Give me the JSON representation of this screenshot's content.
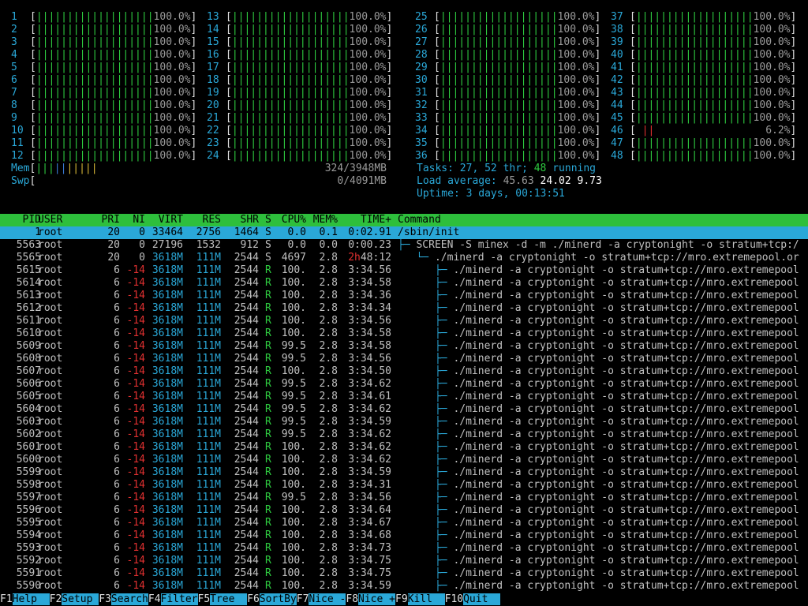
{
  "cpus": [
    {
      "n": "1",
      "pct": "100.0%"
    },
    {
      "n": "2",
      "pct": "100.0%"
    },
    {
      "n": "3",
      "pct": "100.0%"
    },
    {
      "n": "4",
      "pct": "100.0%"
    },
    {
      "n": "5",
      "pct": "100.0%"
    },
    {
      "n": "6",
      "pct": "100.0%"
    },
    {
      "n": "7",
      "pct": "100.0%"
    },
    {
      "n": "8",
      "pct": "100.0%"
    },
    {
      "n": "9",
      "pct": "100.0%"
    },
    {
      "n": "10",
      "pct": "100.0%"
    },
    {
      "n": "11",
      "pct": "100.0%"
    },
    {
      "n": "12",
      "pct": "100.0%"
    },
    {
      "n": "13",
      "pct": "100.0%"
    },
    {
      "n": "14",
      "pct": "100.0%"
    },
    {
      "n": "15",
      "pct": "100.0%"
    },
    {
      "n": "16",
      "pct": "100.0%"
    },
    {
      "n": "17",
      "pct": "100.0%"
    },
    {
      "n": "18",
      "pct": "100.0%"
    },
    {
      "n": "19",
      "pct": "100.0%"
    },
    {
      "n": "20",
      "pct": "100.0%"
    },
    {
      "n": "21",
      "pct": "100.0%"
    },
    {
      "n": "22",
      "pct": "100.0%"
    },
    {
      "n": "23",
      "pct": "100.0%"
    },
    {
      "n": "24",
      "pct": "100.0%"
    },
    {
      "n": "25",
      "pct": "100.0%"
    },
    {
      "n": "26",
      "pct": "100.0%"
    },
    {
      "n": "27",
      "pct": "100.0%"
    },
    {
      "n": "28",
      "pct": "100.0%"
    },
    {
      "n": "29",
      "pct": "100.0%"
    },
    {
      "n": "30",
      "pct": "100.0%"
    },
    {
      "n": "31",
      "pct": "100.0%"
    },
    {
      "n": "32",
      "pct": "100.0%"
    },
    {
      "n": "33",
      "pct": "100.0%"
    },
    {
      "n": "34",
      "pct": "100.0%"
    },
    {
      "n": "35",
      "pct": "100.0%"
    },
    {
      "n": "36",
      "pct": "100.0%"
    },
    {
      "n": "37",
      "pct": "100.0%"
    },
    {
      "n": "38",
      "pct": "100.0%"
    },
    {
      "n": "39",
      "pct": "100.0%"
    },
    {
      "n": "40",
      "pct": "100.0%"
    },
    {
      "n": "41",
      "pct": "100.0%"
    },
    {
      "n": "42",
      "pct": "100.0%"
    },
    {
      "n": "43",
      "pct": "100.0%"
    },
    {
      "n": "44",
      "pct": "100.0%"
    },
    {
      "n": "45",
      "pct": "100.0%"
    },
    {
      "n": "46",
      "pct": "6.2%",
      "low": true
    },
    {
      "n": "47",
      "pct": "100.0%"
    },
    {
      "n": "48",
      "pct": "100.0%"
    }
  ],
  "memory": {
    "mem_label": "Mem",
    "mem_value": "324/3948MB",
    "swp_label": "Swp",
    "swp_value": "0/4091MB"
  },
  "summary": {
    "tasks_label": "Tasks:",
    "tasks_count": "27,",
    "threads": "52 thr;",
    "running_count": "48",
    "running_label": "running",
    "load_label": "Load average:",
    "load1": "45.63",
    "load5": "24.02",
    "load15": "9.73",
    "uptime_label": "Uptime:",
    "uptime_value": "3 days, 00:13:51"
  },
  "table_header": {
    "pid": "PID",
    "user": "USER",
    "pri": "PRI",
    "ni": "NI",
    "virt": "VIRT",
    "res": "RES",
    "shr": "SHR",
    "s": "S",
    "cpu": "CPU%",
    "mem": "MEM%",
    "time": "TIME+",
    "command": "Command"
  },
  "processes": [
    {
      "pid": "1",
      "user": "root",
      "pri": "20",
      "ni": "0",
      "virt": "33464",
      "res": "2756",
      "shr": "1464",
      "s": "S",
      "cpu": "0.0",
      "mem": "0.1",
      "time": "0:02.91",
      "tree": "",
      "cmd": "/sbin/init"
    },
    {
      "pid": "5563",
      "user": "root",
      "pri": "20",
      "ni": "0",
      "virt": "27196",
      "res": "1532",
      "shr": "912",
      "s": "S",
      "cpu": "0.0",
      "mem": "0.0",
      "time": "0:00.23",
      "tree": "├─ ",
      "cmd": "SCREEN -S minex -d -m ./minerd -a cryptonight -o stratum+tcp:/"
    },
    {
      "pid": "5565",
      "user": "root",
      "pri": "20",
      "ni": "0",
      "virt": "3618M",
      "res": "111M",
      "shr": "2544",
      "s": "S",
      "cpu": "4697",
      "mem": "2.8",
      "time": "48:12",
      "time_hours": "2h",
      "tree": "   └─ ",
      "cmd": "./minerd -a cryptonight -o stratum+tcp://mro.extremepool.or"
    },
    {
      "pid": "5615",
      "user": "root",
      "pri": "6",
      "ni": "-14",
      "virt": "3618M",
      "res": "111M",
      "shr": "2544",
      "s": "R",
      "cpu": "100.",
      "mem": "2.8",
      "time": "3:34.56",
      "tree": "      ├─ ",
      "cmd": "./minerd -a cryptonight -o stratum+tcp://mro.extremepool"
    },
    {
      "pid": "5614",
      "user": "root",
      "pri": "6",
      "ni": "-14",
      "virt": "3618M",
      "res": "111M",
      "shr": "2544",
      "s": "R",
      "cpu": "100.",
      "mem": "2.8",
      "time": "3:34.58",
      "tree": "      ├─ ",
      "cmd": "./minerd -a cryptonight -o stratum+tcp://mro.extremepool"
    },
    {
      "pid": "5613",
      "user": "root",
      "pri": "6",
      "ni": "-14",
      "virt": "3618M",
      "res": "111M",
      "shr": "2544",
      "s": "R",
      "cpu": "100.",
      "mem": "2.8",
      "time": "3:34.36",
      "tree": "      ├─ ",
      "cmd": "./minerd -a cryptonight -o stratum+tcp://mro.extremepool"
    },
    {
      "pid": "5612",
      "user": "root",
      "pri": "6",
      "ni": "-14",
      "virt": "3618M",
      "res": "111M",
      "shr": "2544",
      "s": "R",
      "cpu": "100.",
      "mem": "2.8",
      "time": "3:34.34",
      "tree": "      ├─ ",
      "cmd": "./minerd -a cryptonight -o stratum+tcp://mro.extremepool"
    },
    {
      "pid": "5611",
      "user": "root",
      "pri": "6",
      "ni": "-14",
      "virt": "3618M",
      "res": "111M",
      "shr": "2544",
      "s": "R",
      "cpu": "100.",
      "mem": "2.8",
      "time": "3:34.56",
      "tree": "      ├─ ",
      "cmd": "./minerd -a cryptonight -o stratum+tcp://mro.extremepool"
    },
    {
      "pid": "5610",
      "user": "root",
      "pri": "6",
      "ni": "-14",
      "virt": "3618M",
      "res": "111M",
      "shr": "2544",
      "s": "R",
      "cpu": "100.",
      "mem": "2.8",
      "time": "3:34.58",
      "tree": "      ├─ ",
      "cmd": "./minerd -a cryptonight -o stratum+tcp://mro.extremepool"
    },
    {
      "pid": "5609",
      "user": "root",
      "pri": "6",
      "ni": "-14",
      "virt": "3618M",
      "res": "111M",
      "shr": "2544",
      "s": "R",
      "cpu": "99.5",
      "mem": "2.8",
      "time": "3:34.58",
      "tree": "      ├─ ",
      "cmd": "./minerd -a cryptonight -o stratum+tcp://mro.extremepool"
    },
    {
      "pid": "5608",
      "user": "root",
      "pri": "6",
      "ni": "-14",
      "virt": "3618M",
      "res": "111M",
      "shr": "2544",
      "s": "R",
      "cpu": "99.5",
      "mem": "2.8",
      "time": "3:34.56",
      "tree": "      ├─ ",
      "cmd": "./minerd -a cryptonight -o stratum+tcp://mro.extremepool"
    },
    {
      "pid": "5607",
      "user": "root",
      "pri": "6",
      "ni": "-14",
      "virt": "3618M",
      "res": "111M",
      "shr": "2544",
      "s": "R",
      "cpu": "100.",
      "mem": "2.8",
      "time": "3:34.50",
      "tree": "      ├─ ",
      "cmd": "./minerd -a cryptonight -o stratum+tcp://mro.extremepool"
    },
    {
      "pid": "5606",
      "user": "root",
      "pri": "6",
      "ni": "-14",
      "virt": "3618M",
      "res": "111M",
      "shr": "2544",
      "s": "R",
      "cpu": "99.5",
      "mem": "2.8",
      "time": "3:34.62",
      "tree": "      ├─ ",
      "cmd": "./minerd -a cryptonight -o stratum+tcp://mro.extremepool"
    },
    {
      "pid": "5605",
      "user": "root",
      "pri": "6",
      "ni": "-14",
      "virt": "3618M",
      "res": "111M",
      "shr": "2544",
      "s": "R",
      "cpu": "99.5",
      "mem": "2.8",
      "time": "3:34.61",
      "tree": "      ├─ ",
      "cmd": "./minerd -a cryptonight -o stratum+tcp://mro.extremepool"
    },
    {
      "pid": "5604",
      "user": "root",
      "pri": "6",
      "ni": "-14",
      "virt": "3618M",
      "res": "111M",
      "shr": "2544",
      "s": "R",
      "cpu": "99.5",
      "mem": "2.8",
      "time": "3:34.62",
      "tree": "      ├─ ",
      "cmd": "./minerd -a cryptonight -o stratum+tcp://mro.extremepool"
    },
    {
      "pid": "5603",
      "user": "root",
      "pri": "6",
      "ni": "-14",
      "virt": "3618M",
      "res": "111M",
      "shr": "2544",
      "s": "R",
      "cpu": "99.5",
      "mem": "2.8",
      "time": "3:34.59",
      "tree": "      ├─ ",
      "cmd": "./minerd -a cryptonight -o stratum+tcp://mro.extremepool"
    },
    {
      "pid": "5602",
      "user": "root",
      "pri": "6",
      "ni": "-14",
      "virt": "3618M",
      "res": "111M",
      "shr": "2544",
      "s": "R",
      "cpu": "99.5",
      "mem": "2.8",
      "time": "3:34.62",
      "tree": "      ├─ ",
      "cmd": "./minerd -a cryptonight -o stratum+tcp://mro.extremepool"
    },
    {
      "pid": "5601",
      "user": "root",
      "pri": "6",
      "ni": "-14",
      "virt": "3618M",
      "res": "111M",
      "shr": "2544",
      "s": "R",
      "cpu": "100.",
      "mem": "2.8",
      "time": "3:34.62",
      "tree": "      ├─ ",
      "cmd": "./minerd -a cryptonight -o stratum+tcp://mro.extremepool"
    },
    {
      "pid": "5600",
      "user": "root",
      "pri": "6",
      "ni": "-14",
      "virt": "3618M",
      "res": "111M",
      "shr": "2544",
      "s": "R",
      "cpu": "100.",
      "mem": "2.8",
      "time": "3:34.62",
      "tree": "      ├─ ",
      "cmd": "./minerd -a cryptonight -o stratum+tcp://mro.extremepool"
    },
    {
      "pid": "5599",
      "user": "root",
      "pri": "6",
      "ni": "-14",
      "virt": "3618M",
      "res": "111M",
      "shr": "2544",
      "s": "R",
      "cpu": "100.",
      "mem": "2.8",
      "time": "3:34.59",
      "tree": "      ├─ ",
      "cmd": "./minerd -a cryptonight -o stratum+tcp://mro.extremepool"
    },
    {
      "pid": "5598",
      "user": "root",
      "pri": "6",
      "ni": "-14",
      "virt": "3618M",
      "res": "111M",
      "shr": "2544",
      "s": "R",
      "cpu": "100.",
      "mem": "2.8",
      "time": "3:34.31",
      "tree": "      ├─ ",
      "cmd": "./minerd -a cryptonight -o stratum+tcp://mro.extremepool"
    },
    {
      "pid": "5597",
      "user": "root",
      "pri": "6",
      "ni": "-14",
      "virt": "3618M",
      "res": "111M",
      "shr": "2544",
      "s": "R",
      "cpu": "99.5",
      "mem": "2.8",
      "time": "3:34.56",
      "tree": "      ├─ ",
      "cmd": "./minerd -a cryptonight -o stratum+tcp://mro.extremepool"
    },
    {
      "pid": "5596",
      "user": "root",
      "pri": "6",
      "ni": "-14",
      "virt": "3618M",
      "res": "111M",
      "shr": "2544",
      "s": "R",
      "cpu": "100.",
      "mem": "2.8",
      "time": "3:34.64",
      "tree": "      ├─ ",
      "cmd": "./minerd -a cryptonight -o stratum+tcp://mro.extremepool"
    },
    {
      "pid": "5595",
      "user": "root",
      "pri": "6",
      "ni": "-14",
      "virt": "3618M",
      "res": "111M",
      "shr": "2544",
      "s": "R",
      "cpu": "100.",
      "mem": "2.8",
      "time": "3:34.67",
      "tree": "      ├─ ",
      "cmd": "./minerd -a cryptonight -o stratum+tcp://mro.extremepool"
    },
    {
      "pid": "5594",
      "user": "root",
      "pri": "6",
      "ni": "-14",
      "virt": "3618M",
      "res": "111M",
      "shr": "2544",
      "s": "R",
      "cpu": "100.",
      "mem": "2.8",
      "time": "3:34.68",
      "tree": "      ├─ ",
      "cmd": "./minerd -a cryptonight -o stratum+tcp://mro.extremepool"
    },
    {
      "pid": "5593",
      "user": "root",
      "pri": "6",
      "ni": "-14",
      "virt": "3618M",
      "res": "111M",
      "shr": "2544",
      "s": "R",
      "cpu": "100.",
      "mem": "2.8",
      "time": "3:34.73",
      "tree": "      ├─ ",
      "cmd": "./minerd -a cryptonight -o stratum+tcp://mro.extremepool"
    },
    {
      "pid": "5592",
      "user": "root",
      "pri": "6",
      "ni": "-14",
      "virt": "3618M",
      "res": "111M",
      "shr": "2544",
      "s": "R",
      "cpu": "100.",
      "mem": "2.8",
      "time": "3:34.75",
      "tree": "      ├─ ",
      "cmd": "./minerd -a cryptonight -o stratum+tcp://mro.extremepool"
    },
    {
      "pid": "5591",
      "user": "root",
      "pri": "6",
      "ni": "-14",
      "virt": "3618M",
      "res": "111M",
      "shr": "2544",
      "s": "R",
      "cpu": "100.",
      "mem": "2.8",
      "time": "3:34.75",
      "tree": "      ├─ ",
      "cmd": "./minerd -a cryptonight -o stratum+tcp://mro.extremepool"
    },
    {
      "pid": "5590",
      "user": "root",
      "pri": "6",
      "ni": "-14",
      "virt": "3618M",
      "res": "111M",
      "shr": "2544",
      "s": "R",
      "cpu": "100.",
      "mem": "2.8",
      "time": "3:34.59",
      "tree": "      ├─ ",
      "cmd": "./minerd -a cryptonight -o stratum+tcp://mro.extremepool"
    }
  ],
  "footer": [
    {
      "key": "F1",
      "label": "Help  "
    },
    {
      "key": "F2",
      "label": "Setup "
    },
    {
      "key": "F3",
      "label": "Search"
    },
    {
      "key": "F4",
      "label": "Filter"
    },
    {
      "key": "F5",
      "label": "Tree  "
    },
    {
      "key": "F6",
      "label": "SortBy"
    },
    {
      "key": "F7",
      "label": "Nice -"
    },
    {
      "key": "F8",
      "label": "Nice +"
    },
    {
      "key": "F9",
      "label": "Kill  "
    },
    {
      "key": "F10",
      "label": "Quit  "
    }
  ],
  "colors": {
    "cyan": "#2aa8d8",
    "green": "#2ecc40",
    "red": "#e03030",
    "header_bg": "#2ebf3c",
    "selected_bg": "#2aa8d8"
  }
}
